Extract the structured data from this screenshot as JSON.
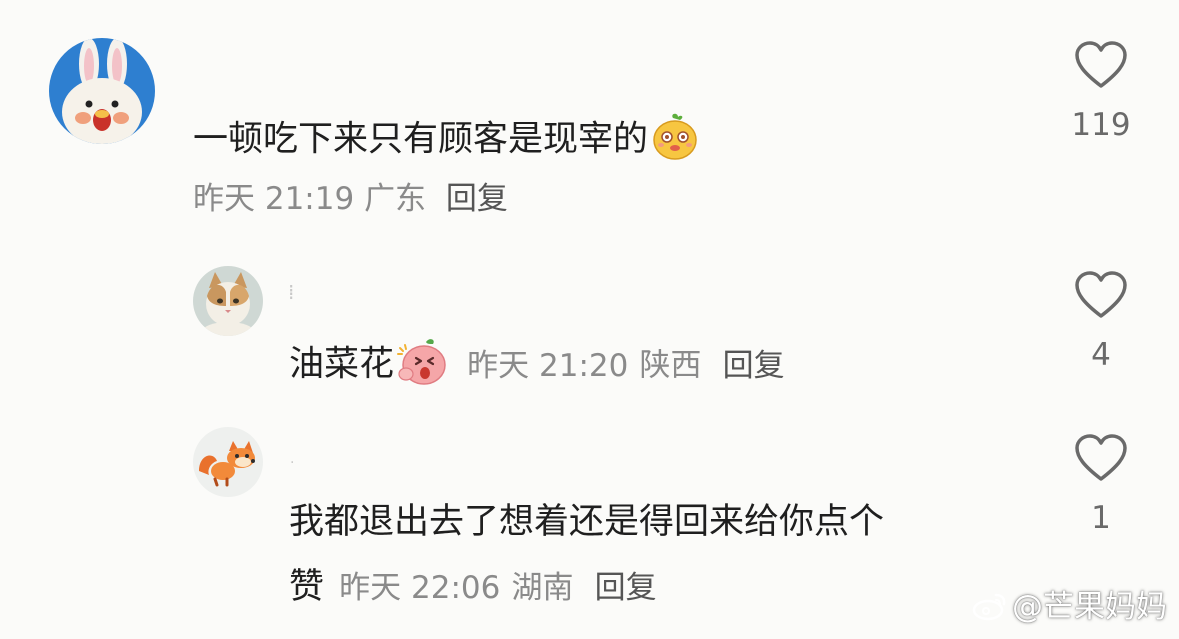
{
  "comments": [
    {
      "content": "一顿吃下来只有顾客是现宰的",
      "emoji": "mango-smile-emoji",
      "time": "昨天 21:19",
      "location": "广东",
      "reply_label": "回复",
      "likes": "119",
      "avatar": "bunny-avatar"
    },
    {
      "content": "油菜花",
      "emoji": "peach-shout-emoji",
      "time": "昨天 21:20",
      "location": "陕西",
      "reply_label": "回复",
      "likes": "4",
      "avatar": "cat-avatar"
    },
    {
      "content_line1": "我都退出去了想着还是得回来给你点个",
      "content_line2": "赞",
      "time": "昨天 22:06",
      "location": "湖南",
      "reply_label": "回复",
      "likes": "1",
      "avatar": "fox-avatar"
    }
  ],
  "watermark": {
    "text": "@芒果妈妈",
    "icon": "weibo-icon"
  }
}
